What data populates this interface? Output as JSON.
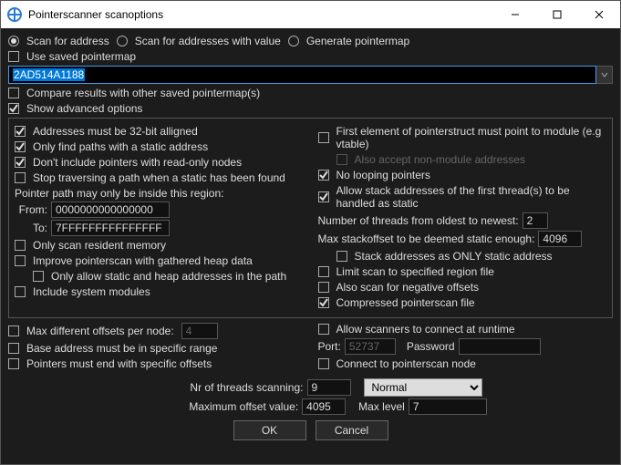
{
  "titlebar": {
    "title": "Pointerscanner scanoptions"
  },
  "radios": {
    "scan_for_address": {
      "label": "Scan for address",
      "checked": true
    },
    "scan_for_value": {
      "label": "Scan for addresses with value",
      "checked": false
    },
    "generate_pointermap": {
      "label": "Generate pointermap",
      "checked": false
    }
  },
  "use_saved_pointermap": {
    "label": "Use saved pointermap",
    "checked": false
  },
  "address": "2AD514A1188",
  "compare_results": {
    "label": "Compare results with other saved pointermap(s)",
    "checked": false
  },
  "show_advanced": {
    "label": "Show advanced options",
    "checked": true
  },
  "adv": {
    "left": {
      "aligned_32": {
        "label": "Addresses must be 32-bit alligned",
        "checked": true
      },
      "only_static": {
        "label": "Only find paths with a static address",
        "checked": true
      },
      "no_readonly": {
        "label": "Don't include pointers with read-only nodes",
        "checked": true
      },
      "stop_on_static": {
        "label": "Stop traversing a path when a static has been found",
        "checked": false
      },
      "region_label": "Pointer path may only be inside this region:",
      "from_label": "From:",
      "from_value": "0000000000000000",
      "to_label": "To:",
      "to_value": "7FFFFFFFFFFFFFFF",
      "resident_only": {
        "label": "Only scan resident memory",
        "checked": false
      },
      "improve_heap": {
        "label": "Improve pointerscan with gathered heap data",
        "checked": false
      },
      "only_static_heap": {
        "label": "Only allow static and heap addresses in the path",
        "checked": false
      },
      "include_sysmod": {
        "label": "Include system modules",
        "checked": false
      }
    },
    "right": {
      "first_to_module": {
        "label": "First element of pointerstruct must point to module (e.g vtable)",
        "checked": false
      },
      "also_nonmodule": {
        "label": "Also accept non-module addresses",
        "checked": false,
        "disabled": true
      },
      "no_looping": {
        "label": "No looping pointers",
        "checked": true
      },
      "allow_stack": {
        "label": "Allow stack addresses of the first thread(s) to be handled as static",
        "checked": true
      },
      "threads_label": "Number of threads from oldest to newest:",
      "threads_value": "2",
      "max_stack_label": "Max stackoffset to be deemed static enough:",
      "max_stack_value": "4096",
      "stack_only": {
        "label": "Stack addresses as ONLY static address",
        "checked": false
      },
      "limit_region_file": {
        "label": "Limit scan to specified region file",
        "checked": false
      },
      "scan_negative": {
        "label": "Also scan for negative offsets",
        "checked": false
      },
      "compressed_file": {
        "label": "Compressed pointerscan file",
        "checked": true
      }
    }
  },
  "max_diff_offsets": {
    "label": "Max different offsets per node:",
    "checked": false,
    "value": "4"
  },
  "base_in_range": {
    "label": "Base address must be in specific range",
    "checked": false
  },
  "end_specific_offsets": {
    "label": "Pointers must end with specific offsets",
    "checked": false
  },
  "allow_runtime": {
    "label": "Allow scanners to connect at runtime",
    "checked": false
  },
  "port": {
    "label": "Port:",
    "value": "52737"
  },
  "password": {
    "label": "Password",
    "value": ""
  },
  "connect_node": {
    "label": "Connect to pointerscan node",
    "checked": false
  },
  "threads_scanning": {
    "label": "Nr of threads scanning:",
    "value": "9"
  },
  "thread_priority": "Normal",
  "max_offset": {
    "label": "Maximum offset value:",
    "value": "4095"
  },
  "max_level": {
    "label": "Max level",
    "value": "7"
  },
  "buttons": {
    "ok": "OK",
    "cancel": "Cancel"
  }
}
